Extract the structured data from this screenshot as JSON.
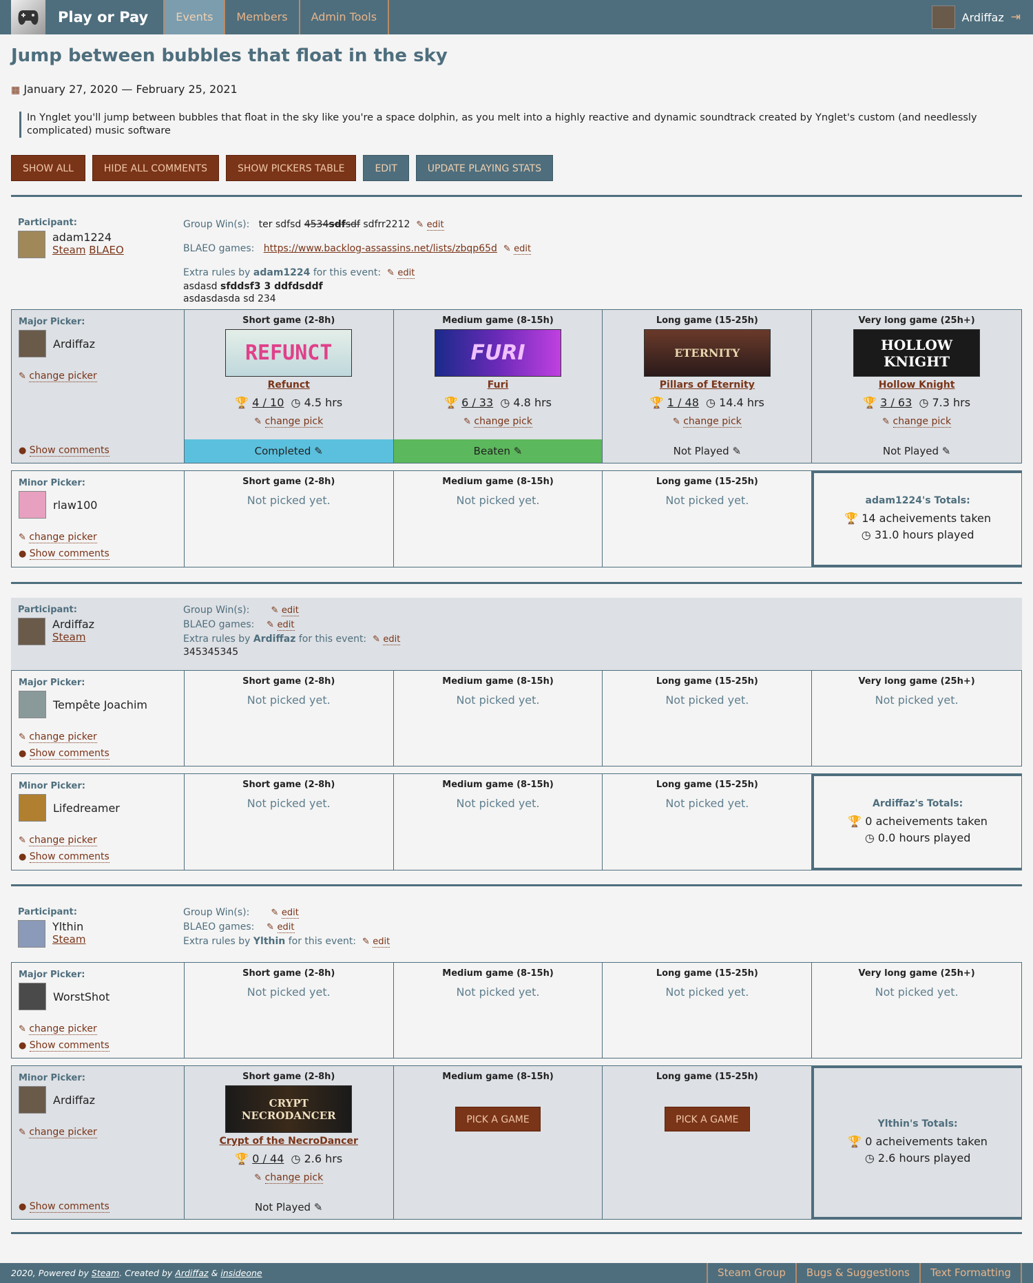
{
  "nav": {
    "brand": "Play or Pay",
    "tabs": [
      "Events",
      "Members",
      "Admin Tools"
    ],
    "user": "Ardiffaz"
  },
  "event": {
    "title": "Jump between bubbles that float in the sky",
    "dates": "January 27, 2020 — February 25, 2021",
    "description": "In Ynglet you'll jump between bubbles that float in the sky like you're a space dolphin, as you melt into a highly reactive and dynamic soundtrack created by Ynglet's custom (and needlessly complicated) music software"
  },
  "actions": {
    "show_all": "SHOW ALL",
    "hide_comments": "HIDE ALL COMMENTS",
    "show_pickers": "SHOW PICKERS TABLE",
    "edit": "EDIT",
    "update_stats": "UPDATE PLAYING STATS"
  },
  "common": {
    "participant": "Participant:",
    "major_picker": "Major Picker:",
    "minor_picker": "Minor Picker:",
    "group_wins": "Group Win(s):",
    "blaeo_games": "BLAEO games:",
    "extra_rules_prefix": "Extra rules by",
    "extra_rules_suffix": "for this event:",
    "edit": "edit",
    "steam": "Steam",
    "blaeo": "BLAEO",
    "change_picker": "change picker",
    "show_comments": "Show comments",
    "change_pick": "change pick",
    "short": "Short game (2-8h)",
    "medium": "Medium game (8-15h)",
    "long": "Long game (15-25h)",
    "very_long": "Very long game (25h+)",
    "not_picked": "Not picked yet.",
    "pick_a_game": "PICK A GAME",
    "ach_taken": "acheivements taken",
    "hrs_played": "hours played"
  },
  "p1": {
    "name": "adam1224",
    "group_wins_a": "ter sdfsd ",
    "group_wins_strike1": "4534",
    "group_wins_bold": "sdf",
    "group_wins_strike2": "sdf",
    "group_wins_b": " sdfrr2212",
    "blaeo_url": "https://www.backlog-assassins.net/lists/zbqp65d",
    "rules_line1_a": "asdasd ",
    "rules_line1_b": "sfddsf3 3 ddfdsddf",
    "rules_line2": "asdasdasda sd 234",
    "major": "Ardiffaz",
    "minor": "rlaw100",
    "games": [
      {
        "name": "Refunct",
        "art": "REFUNCT",
        "ach": "4 / 10",
        "hrs": "4.5 hrs",
        "status": "Completed"
      },
      {
        "name": "Furi",
        "art": "FURI",
        "ach": "6 / 33",
        "hrs": "4.8 hrs",
        "status": "Beaten"
      },
      {
        "name": "Pillars of Eternity",
        "art": "ETERNITY",
        "ach": "1 / 48",
        "hrs": "14.4 hrs",
        "status": "Not Played"
      },
      {
        "name": "Hollow Knight",
        "art": "HOLLOW KNIGHT",
        "ach": "3 / 63",
        "hrs": "7.3 hrs",
        "status": "Not Played"
      }
    ],
    "totals_title": "adam1224's Totals:",
    "totals_ach": "14",
    "totals_hrs": "31.0"
  },
  "p2": {
    "name": "Ardiffaz",
    "rules_text": "345345345",
    "major": "Tempête Joachim",
    "minor": "Lifedreamer",
    "totals_title": "Ardiffaz's Totals:",
    "totals_ach": "0",
    "totals_hrs": "0.0"
  },
  "p3": {
    "name": "Ylthin",
    "major": "WorstShot",
    "minor": "Ardiffaz",
    "game": {
      "name": "Crypt of the NecroDancer",
      "art": "CRYPT NECRODANCER",
      "ach": "0 / 44",
      "hrs": "2.6 hrs",
      "status": "Not Played"
    },
    "totals_title": "Ylthin's Totals:",
    "totals_ach": "0",
    "totals_hrs": "2.6"
  },
  "footer": {
    "year": "2020, Powered by ",
    "steam": "Steam",
    "created": ". Created by ",
    "author1": "Ardiffaz",
    "amp": " & ",
    "author2": "insideone",
    "links": [
      "Steam Group",
      "Bugs & Suggestions",
      "Text Formatting"
    ]
  },
  "colors": {
    "accent": "#4e6e7d",
    "action": "#7a3418",
    "completed": "#5bc0de",
    "beaten": "#5cb85c"
  }
}
